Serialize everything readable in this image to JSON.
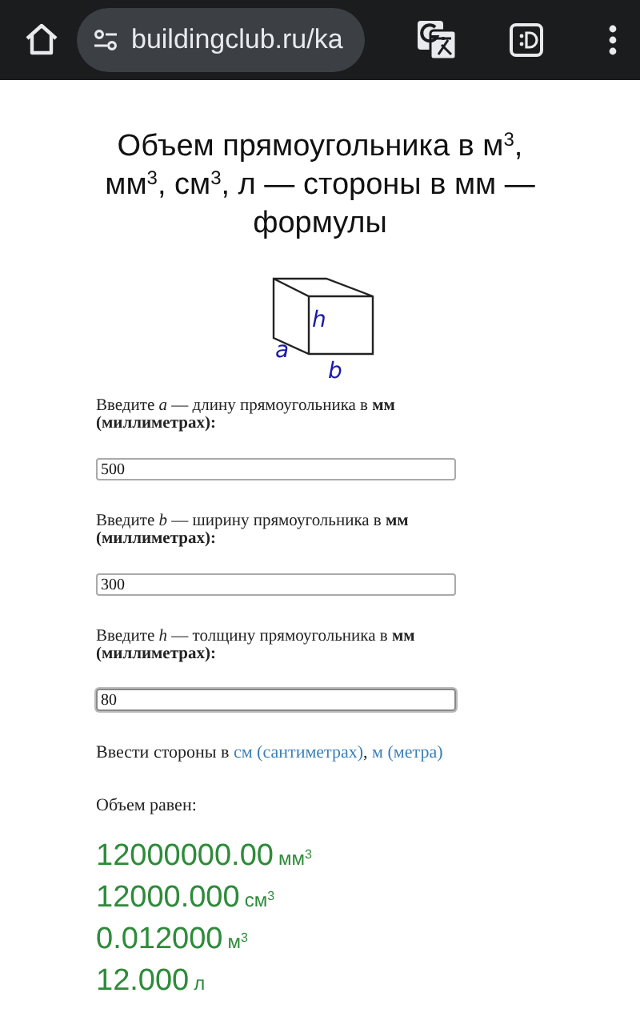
{
  "browser": {
    "url": "buildingclub.ru/ka"
  },
  "title": "Объем прямоугольника в м$^{3}$, мм$^{3}$, см$^{3}$, л — стороны в мм — формулы",
  "figure": {
    "labels": [
      "h",
      "a",
      "b"
    ]
  },
  "fields": [
    {
      "label": "Введите *a* — длину прямоугольника в **мм (миллиметрах):**",
      "value": "500",
      "focused": false
    },
    {
      "label": "Введите *b* — ширину прямоугольника в **мм (миллиметрах):**",
      "value": "300",
      "focused": false
    },
    {
      "label": "Введите *h* — толщину прямоугольника в **мм (миллиметрах):**",
      "value": "80",
      "focused": true
    }
  ],
  "units_line": {
    "prefix": "Ввести стороны в",
    "links": [
      "см (сантиметрах)",
      "м (метра)"
    ],
    "separator": ","
  },
  "result_label": "Объем равен:",
  "results": [
    {
      "value": "12000000.00",
      "unit": "мм$^{3}$"
    },
    {
      "value": "12000.000",
      "unit": "см$^{3}$"
    },
    {
      "value": "0.012000",
      "unit": "м$^{3}$"
    },
    {
      "value": "12.000",
      "unit": "л"
    }
  ]
}
